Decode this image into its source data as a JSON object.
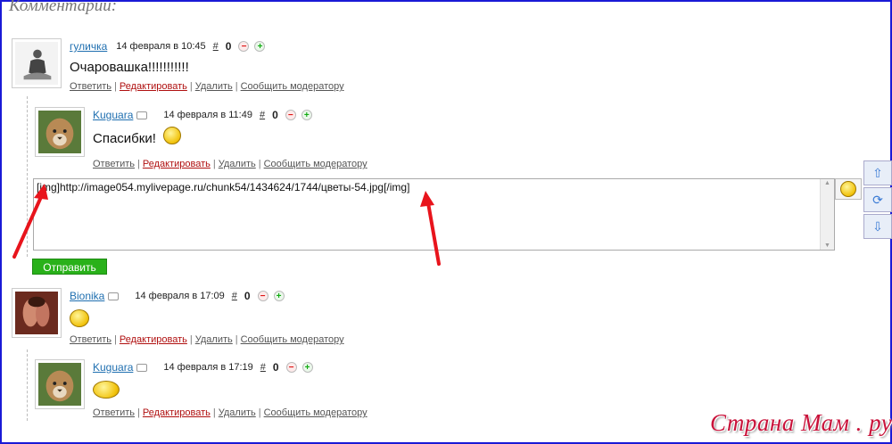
{
  "heading": "Комментарии:",
  "actions": {
    "reply": "Ответить",
    "edit": "Редактировать",
    "delete": "Удалить",
    "report": "Сообщить модератору",
    "sep": "|"
  },
  "hash": "#",
  "comments": [
    {
      "author": "гуличка",
      "date": "14 февраля в 10:45",
      "score": "0",
      "text": "Очаровашка!!!!!!!!!!!"
    },
    {
      "author": "Kuguara",
      "date": "14 февраля в 11:49",
      "score": "0",
      "text": "Спасибки!"
    },
    {
      "author": "Bionika",
      "date": "14 февраля в 17:09",
      "score": "0",
      "text": ""
    },
    {
      "author": "Kuguara",
      "date": "14 февраля в 17:19",
      "score": "0",
      "text": ""
    }
  ],
  "reply_box": {
    "value": "[img]http://image054.mylivepage.ru/chunk54/1434624/1744/цветы-54.jpg[/img]",
    "submit_label": "Отправить"
  },
  "vote": {
    "minus": "−",
    "plus": "+"
  },
  "side_buttons": {
    "up": "⇧",
    "refresh": "⟳",
    "down": "⇩"
  },
  "logo": "Страна Мам . ру",
  "colors": {
    "accent": "#29b11a",
    "link": "#1f6fb0",
    "edit": "#b01010",
    "arrow": "#e8141c",
    "border": "#1a1ad6"
  }
}
